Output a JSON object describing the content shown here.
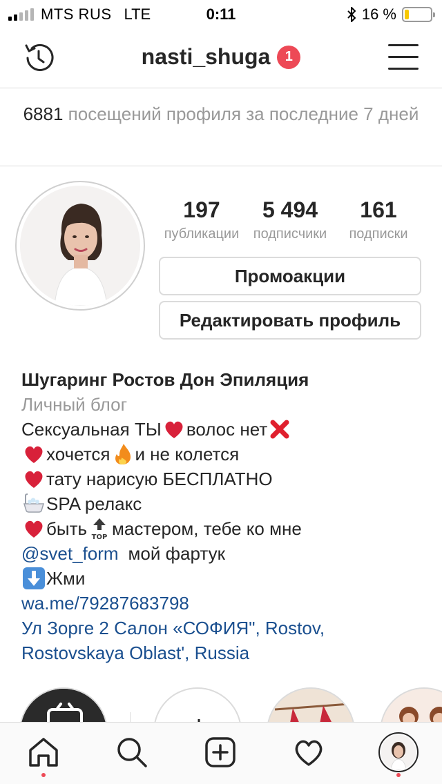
{
  "status_bar": {
    "carrier": "MTS RUS",
    "network": "LTE",
    "time": "0:11",
    "battery_text": "16 %",
    "battery_level": 0.16,
    "signal_bars_active": 2,
    "icons": [
      "signal-icon",
      "bluetooth-icon",
      "battery-icon"
    ]
  },
  "header": {
    "username": "nasti_shuga",
    "notification_count": "1",
    "left_icon": "history-icon",
    "right_icon": "menu-icon"
  },
  "visits": {
    "count": "6881",
    "text": "посещений профиля за последние 7 дней"
  },
  "stats": [
    {
      "value": "197",
      "label": "публикации"
    },
    {
      "value": "5 494",
      "label": "подписчики"
    },
    {
      "value": "161",
      "label": "подписки"
    }
  ],
  "buttons": {
    "promo": "Промоакции",
    "edit": "Редактировать профиль"
  },
  "bio": {
    "name": "Шугаринг Ростов Дон Эпиляция",
    "category": "Личный блог",
    "line1_a": "Сексуальная ТЫ",
    "line1_b": "волос нет",
    "line2_a": "хочется",
    "line2_b": "и не колется",
    "line3": "тату нарисую БЕСПЛАТНО",
    "line4": "SPA релакс",
    "line5_a": "быть",
    "line5_b": "мастером, тебе ко мне",
    "mention": "@svet_form",
    "line6_rest": "мой фартук",
    "line7": "Жми",
    "link": "wa.me/79287683798",
    "address_1": "Ул Зорге 2 Салон «СОФИЯ\", Rostov,",
    "address_2": "Rostovskaya Oblast', Russia"
  },
  "tabbar": {
    "items": [
      "home-icon",
      "search-icon",
      "add-post-icon",
      "heart-icon",
      "profile-avatar"
    ],
    "accent": "#ed4956"
  },
  "colors": {
    "text": "#262626",
    "secondary": "#999999",
    "link": "#1a4f8f",
    "border": "#dbdbdb",
    "badge": "#ed4956"
  }
}
